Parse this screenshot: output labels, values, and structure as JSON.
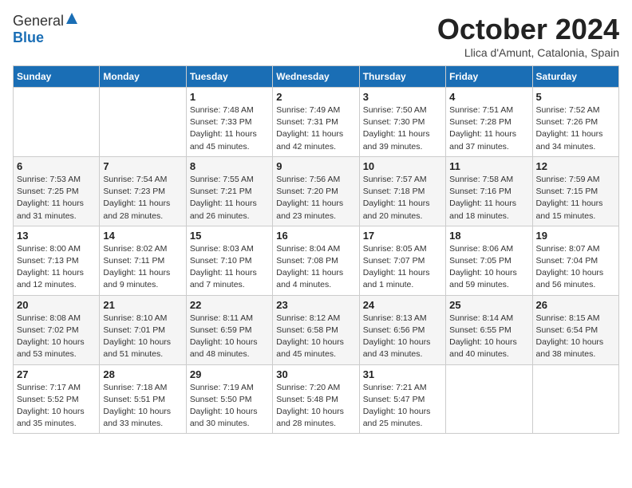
{
  "logo": {
    "general": "General",
    "blue": "Blue"
  },
  "header": {
    "month": "October 2024",
    "location": "Llica d'Amunt, Catalonia, Spain"
  },
  "weekdays": [
    "Sunday",
    "Monday",
    "Tuesday",
    "Wednesday",
    "Thursday",
    "Friday",
    "Saturday"
  ],
  "weeks": [
    [
      null,
      null,
      {
        "day": "1",
        "sunrise": "Sunrise: 7:48 AM",
        "sunset": "Sunset: 7:33 PM",
        "daylight": "Daylight: 11 hours and 45 minutes."
      },
      {
        "day": "2",
        "sunrise": "Sunrise: 7:49 AM",
        "sunset": "Sunset: 7:31 PM",
        "daylight": "Daylight: 11 hours and 42 minutes."
      },
      {
        "day": "3",
        "sunrise": "Sunrise: 7:50 AM",
        "sunset": "Sunset: 7:30 PM",
        "daylight": "Daylight: 11 hours and 39 minutes."
      },
      {
        "day": "4",
        "sunrise": "Sunrise: 7:51 AM",
        "sunset": "Sunset: 7:28 PM",
        "daylight": "Daylight: 11 hours and 37 minutes."
      },
      {
        "day": "5",
        "sunrise": "Sunrise: 7:52 AM",
        "sunset": "Sunset: 7:26 PM",
        "daylight": "Daylight: 11 hours and 34 minutes."
      }
    ],
    [
      {
        "day": "6",
        "sunrise": "Sunrise: 7:53 AM",
        "sunset": "Sunset: 7:25 PM",
        "daylight": "Daylight: 11 hours and 31 minutes."
      },
      {
        "day": "7",
        "sunrise": "Sunrise: 7:54 AM",
        "sunset": "Sunset: 7:23 PM",
        "daylight": "Daylight: 11 hours and 28 minutes."
      },
      {
        "day": "8",
        "sunrise": "Sunrise: 7:55 AM",
        "sunset": "Sunset: 7:21 PM",
        "daylight": "Daylight: 11 hours and 26 minutes."
      },
      {
        "day": "9",
        "sunrise": "Sunrise: 7:56 AM",
        "sunset": "Sunset: 7:20 PM",
        "daylight": "Daylight: 11 hours and 23 minutes."
      },
      {
        "day": "10",
        "sunrise": "Sunrise: 7:57 AM",
        "sunset": "Sunset: 7:18 PM",
        "daylight": "Daylight: 11 hours and 20 minutes."
      },
      {
        "day": "11",
        "sunrise": "Sunrise: 7:58 AM",
        "sunset": "Sunset: 7:16 PM",
        "daylight": "Daylight: 11 hours and 18 minutes."
      },
      {
        "day": "12",
        "sunrise": "Sunrise: 7:59 AM",
        "sunset": "Sunset: 7:15 PM",
        "daylight": "Daylight: 11 hours and 15 minutes."
      }
    ],
    [
      {
        "day": "13",
        "sunrise": "Sunrise: 8:00 AM",
        "sunset": "Sunset: 7:13 PM",
        "daylight": "Daylight: 11 hours and 12 minutes."
      },
      {
        "day": "14",
        "sunrise": "Sunrise: 8:02 AM",
        "sunset": "Sunset: 7:11 PM",
        "daylight": "Daylight: 11 hours and 9 minutes."
      },
      {
        "day": "15",
        "sunrise": "Sunrise: 8:03 AM",
        "sunset": "Sunset: 7:10 PM",
        "daylight": "Daylight: 11 hours and 7 minutes."
      },
      {
        "day": "16",
        "sunrise": "Sunrise: 8:04 AM",
        "sunset": "Sunset: 7:08 PM",
        "daylight": "Daylight: 11 hours and 4 minutes."
      },
      {
        "day": "17",
        "sunrise": "Sunrise: 8:05 AM",
        "sunset": "Sunset: 7:07 PM",
        "daylight": "Daylight: 11 hours and 1 minute."
      },
      {
        "day": "18",
        "sunrise": "Sunrise: 8:06 AM",
        "sunset": "Sunset: 7:05 PM",
        "daylight": "Daylight: 10 hours and 59 minutes."
      },
      {
        "day": "19",
        "sunrise": "Sunrise: 8:07 AM",
        "sunset": "Sunset: 7:04 PM",
        "daylight": "Daylight: 10 hours and 56 minutes."
      }
    ],
    [
      {
        "day": "20",
        "sunrise": "Sunrise: 8:08 AM",
        "sunset": "Sunset: 7:02 PM",
        "daylight": "Daylight: 10 hours and 53 minutes."
      },
      {
        "day": "21",
        "sunrise": "Sunrise: 8:10 AM",
        "sunset": "Sunset: 7:01 PM",
        "daylight": "Daylight: 10 hours and 51 minutes."
      },
      {
        "day": "22",
        "sunrise": "Sunrise: 8:11 AM",
        "sunset": "Sunset: 6:59 PM",
        "daylight": "Daylight: 10 hours and 48 minutes."
      },
      {
        "day": "23",
        "sunrise": "Sunrise: 8:12 AM",
        "sunset": "Sunset: 6:58 PM",
        "daylight": "Daylight: 10 hours and 45 minutes."
      },
      {
        "day": "24",
        "sunrise": "Sunrise: 8:13 AM",
        "sunset": "Sunset: 6:56 PM",
        "daylight": "Daylight: 10 hours and 43 minutes."
      },
      {
        "day": "25",
        "sunrise": "Sunrise: 8:14 AM",
        "sunset": "Sunset: 6:55 PM",
        "daylight": "Daylight: 10 hours and 40 minutes."
      },
      {
        "day": "26",
        "sunrise": "Sunrise: 8:15 AM",
        "sunset": "Sunset: 6:54 PM",
        "daylight": "Daylight: 10 hours and 38 minutes."
      }
    ],
    [
      {
        "day": "27",
        "sunrise": "Sunrise: 7:17 AM",
        "sunset": "Sunset: 5:52 PM",
        "daylight": "Daylight: 10 hours and 35 minutes."
      },
      {
        "day": "28",
        "sunrise": "Sunrise: 7:18 AM",
        "sunset": "Sunset: 5:51 PM",
        "daylight": "Daylight: 10 hours and 33 minutes."
      },
      {
        "day": "29",
        "sunrise": "Sunrise: 7:19 AM",
        "sunset": "Sunset: 5:50 PM",
        "daylight": "Daylight: 10 hours and 30 minutes."
      },
      {
        "day": "30",
        "sunrise": "Sunrise: 7:20 AM",
        "sunset": "Sunset: 5:48 PM",
        "daylight": "Daylight: 10 hours and 28 minutes."
      },
      {
        "day": "31",
        "sunrise": "Sunrise: 7:21 AM",
        "sunset": "Sunset: 5:47 PM",
        "daylight": "Daylight: 10 hours and 25 minutes."
      },
      null,
      null
    ]
  ]
}
